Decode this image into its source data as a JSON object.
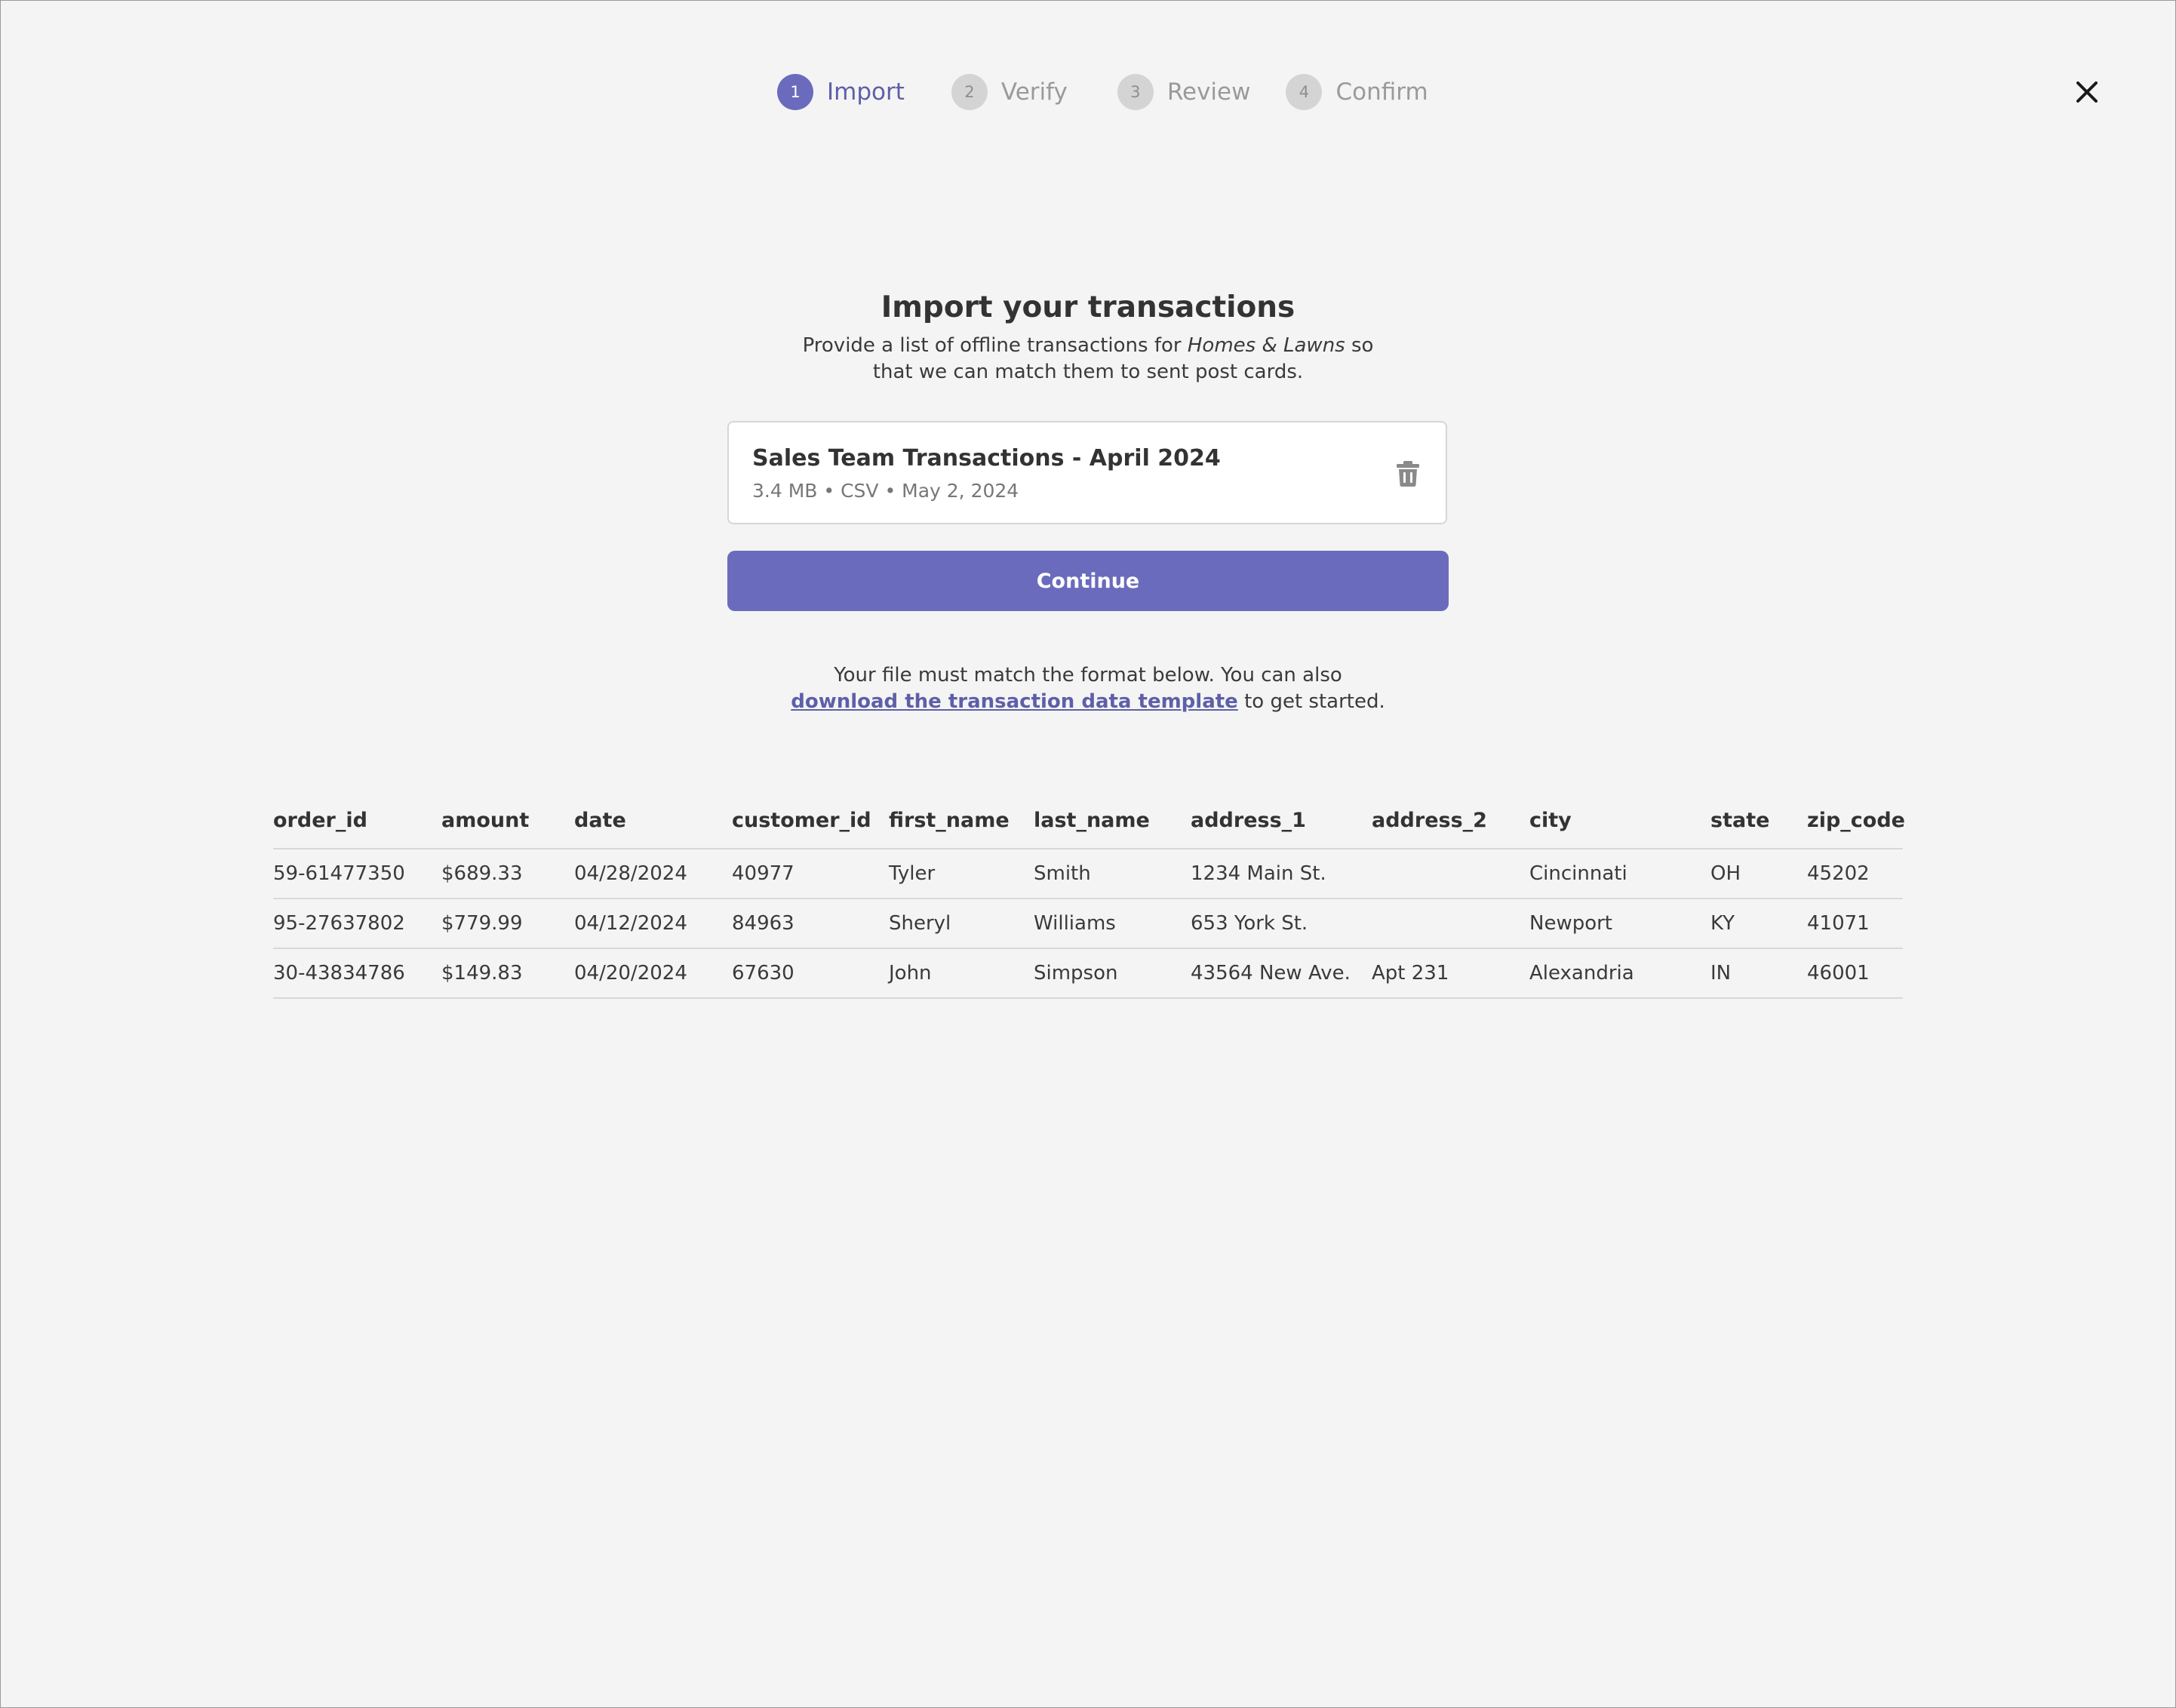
{
  "stepper": {
    "steps": [
      {
        "number": "1",
        "label": "Import",
        "state": "active"
      },
      {
        "number": "2",
        "label": "Verify",
        "state": "inactive"
      },
      {
        "number": "3",
        "label": "Review",
        "state": "inactive"
      },
      {
        "number": "4",
        "label": "Confirm",
        "state": "inactive"
      }
    ]
  },
  "header": {
    "close_icon": "close-icon"
  },
  "main": {
    "title": "Import your transactions",
    "subtitle_before": "Provide a list of offline transactions for ",
    "subtitle_emphasis": "Homes & Lawns",
    "subtitle_after": " so that we can match them to sent post cards."
  },
  "file": {
    "name": "Sales Team Transactions - April 2024",
    "meta": "3.4 MB • CSV • May 2, 2024",
    "delete_icon": "trash-icon"
  },
  "continue_label": "Continue",
  "help": {
    "line1": "Your file must match  the format below. You can also",
    "link_text": "download the transaction data template",
    "after_link": " to get started."
  },
  "table": {
    "columns": [
      "order_id",
      "amount",
      "date",
      "customer_id",
      "first_name",
      "last_name",
      "address_1",
      "address_2",
      "city",
      "state",
      "zip_code"
    ],
    "rows": [
      [
        "59-61477350",
        "$689.33",
        "04/28/2024",
        "40977",
        "Tyler",
        "Smith",
        "1234 Main St.",
        "",
        "Cincinnati",
        "OH",
        "45202"
      ],
      [
        "95-27637802",
        "$779.99",
        "04/12/2024",
        "84963",
        "Sheryl",
        "Williams",
        "653 York St.",
        "",
        "Newport",
        "KY",
        "41071"
      ],
      [
        "30-43834786",
        "$149.83",
        "04/20/2024",
        "67630",
        "John",
        "Simpson",
        "43564 New Ave.",
        "Apt 231",
        "Alexandria",
        "IN",
        "46001"
      ]
    ]
  },
  "colors": {
    "accent": "#6a6bbd",
    "background": "#f4f4f4"
  }
}
